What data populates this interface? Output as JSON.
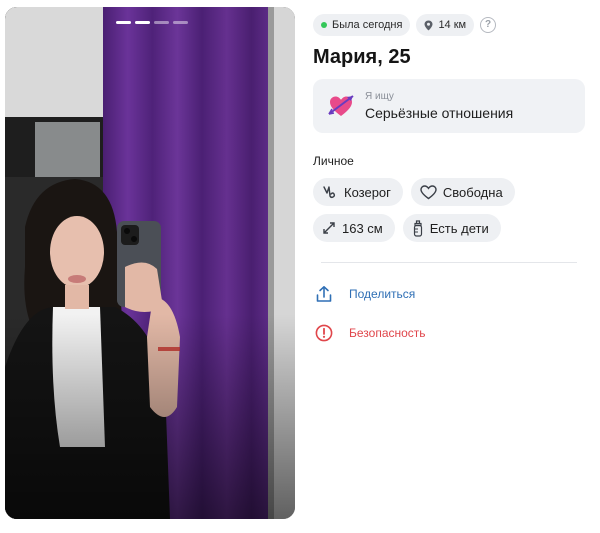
{
  "profile": {
    "status_label": "Была сегодня",
    "distance_label": "14 км",
    "help_symbol": "?",
    "name_age": "Мария, 25",
    "seeking": {
      "label": "Я ищу",
      "value": "Серьёзные отношения",
      "icon": "heart-arrow-icon"
    },
    "personal": {
      "title": "Личное",
      "chips": [
        {
          "label": "Козерог",
          "icon": "capricorn-icon"
        },
        {
          "label": "Свободна",
          "icon": "heart-outline-icon"
        },
        {
          "label": "163 см",
          "icon": "height-arrows-icon"
        },
        {
          "label": "Есть дети",
          "icon": "baby-bottle-icon"
        }
      ]
    },
    "actions": {
      "share": "Поделиться",
      "safety": "Безопасность"
    }
  },
  "photo": {
    "count": 4,
    "active_index": 1
  },
  "colors": {
    "online": "#34c759",
    "share": "#2f6fb5",
    "safety": "#e0464b",
    "curtain": "#5a2a86",
    "chip_bg": "#eef0f3"
  }
}
